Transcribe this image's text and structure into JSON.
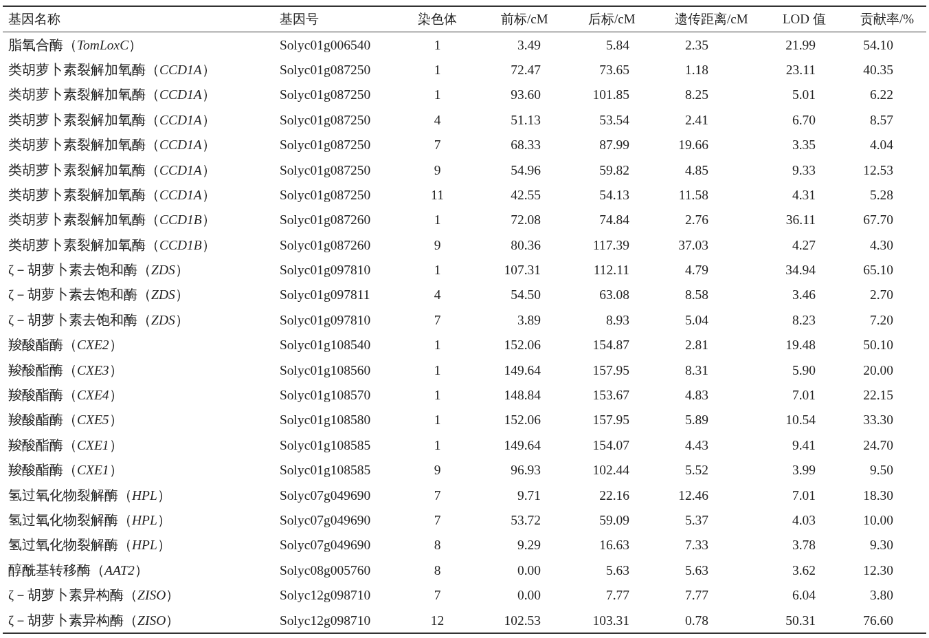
{
  "table": {
    "columns": [
      "基因名称",
      "基因号",
      "染色体",
      "前标/cM",
      "后标/cM",
      "遗传距离/cM",
      "LOD 值",
      "贡献率/%"
    ],
    "rows": [
      [
        "脂氧合酶（*TomLoxC*）",
        "Solyc01g006540",
        "1",
        "3.49",
        "5.84",
        "2.35",
        "21.99",
        "54.10"
      ],
      [
        "类胡萝卜素裂解加氧酶（*CCD1A*）",
        "Solyc01g087250",
        "1",
        "72.47",
        "73.65",
        "1.18",
        "23.11",
        "40.35"
      ],
      [
        "类胡萝卜素裂解加氧酶（*CCD1A*）",
        "Solyc01g087250",
        "1",
        "93.60",
        "101.85",
        "8.25",
        "5.01",
        "6.22"
      ],
      [
        "类胡萝卜素裂解加氧酶（*CCD1A*）",
        "Solyc01g087250",
        "4",
        "51.13",
        "53.54",
        "2.41",
        "6.70",
        "8.57"
      ],
      [
        "类胡萝卜素裂解加氧酶（*CCD1A*）",
        "Solyc01g087250",
        "7",
        "68.33",
        "87.99",
        "19.66",
        "3.35",
        "4.04"
      ],
      [
        "类胡萝卜素裂解加氧酶（*CCD1A*）",
        "Solyc01g087250",
        "9",
        "54.96",
        "59.82",
        "4.85",
        "9.33",
        "12.53"
      ],
      [
        "类胡萝卜素裂解加氧酶（*CCD1A*）",
        "Solyc01g087250",
        "11",
        "42.55",
        "54.13",
        "11.58",
        "4.31",
        "5.28"
      ],
      [
        "类胡萝卜素裂解加氧酶（*CCD1B*）",
        "Solyc01g087260",
        "1",
        "72.08",
        "74.84",
        "2.76",
        "36.11",
        "67.70"
      ],
      [
        "类胡萝卜素裂解加氧酶（*CCD1B*）",
        "Solyc01g087260",
        "9",
        "80.36",
        "117.39",
        "37.03",
        "4.27",
        "4.30"
      ],
      [
        "ζ－胡萝卜素去饱和酶（*ZDS*）",
        "Solyc01g097810",
        "1",
        "107.31",
        "112.11",
        "4.79",
        "34.94",
        "65.10"
      ],
      [
        "ζ－胡萝卜素去饱和酶（*ZDS*）",
        "Solyc01g097811",
        "4",
        "54.50",
        "63.08",
        "8.58",
        "3.46",
        "2.70"
      ],
      [
        "ζ－胡萝卜素去饱和酶（*ZDS*）",
        "Solyc01g097810",
        "7",
        "3.89",
        "8.93",
        "5.04",
        "8.23",
        "7.20"
      ],
      [
        "羧酸酯酶（*CXE2*）",
        "Solyc01g108540",
        "1",
        "152.06",
        "154.87",
        "2.81",
        "19.48",
        "50.10"
      ],
      [
        "羧酸酯酶（*CXE3*）",
        "Solyc01g108560",
        "1",
        "149.64",
        "157.95",
        "8.31",
        "5.90",
        "20.00"
      ],
      [
        "羧酸酯酶（*CXE4*）",
        "Solyc01g108570",
        "1",
        "148.84",
        "153.67",
        "4.83",
        "7.01",
        "22.15"
      ],
      [
        "羧酸酯酶（*CXE5*）",
        "Solyc01g108580",
        "1",
        "152.06",
        "157.95",
        "5.89",
        "10.54",
        "33.30"
      ],
      [
        "羧酸酯酶（*CXE1*）",
        "Solyc01g108585",
        "1",
        "149.64",
        "154.07",
        "4.43",
        "9.41",
        "24.70"
      ],
      [
        "羧酸酯酶（*CXE1*）",
        "Solyc01g108585",
        "9",
        "96.93",
        "102.44",
        "5.52",
        "3.99",
        "9.50"
      ],
      [
        "氢过氧化物裂解酶（*HPL*）",
        "Solyc07g049690",
        "7",
        "9.71",
        "22.16",
        "12.46",
        "7.01",
        "18.30"
      ],
      [
        "氢过氧化物裂解酶（*HPL*）",
        "Solyc07g049690",
        "7",
        "53.72",
        "59.09",
        "5.37",
        "4.03",
        "10.00"
      ],
      [
        "氢过氧化物裂解酶（*HPL*）",
        "Solyc07g049690",
        "8",
        "9.29",
        "16.63",
        "7.33",
        "3.78",
        "9.30"
      ],
      [
        "醇酰基转移酶（*AAT2*）",
        "Solyc08g005760",
        "8",
        "0.00",
        "5.63",
        "5.63",
        "3.62",
        "12.30"
      ],
      [
        "ζ－胡萝卜素异构酶（*ZISO*）",
        "Solyc12g098710",
        "7",
        "0.00",
        "7.77",
        "7.77",
        "6.04",
        "3.80"
      ],
      [
        "ζ－胡萝卜素异构酶（*ZISO*）",
        "Solyc12g098710",
        "12",
        "102.53",
        "103.31",
        "0.78",
        "50.31",
        "76.60"
      ]
    ]
  }
}
